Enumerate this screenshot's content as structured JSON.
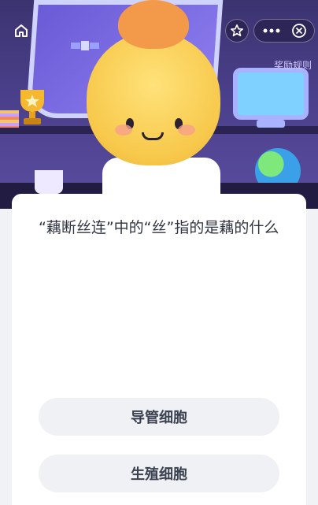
{
  "header": {
    "home_icon": "home-icon",
    "star_icon": "star-icon",
    "more_icon": "more-icon",
    "close_icon": "close-icon",
    "reward_rules": "奖励规则"
  },
  "question": {
    "text": "“藕断丝连”中的“丝”指的是藕的什么"
  },
  "options": [
    {
      "label": "导管细胞"
    },
    {
      "label": "生殖细胞"
    }
  ],
  "colors": {
    "hero_background": "#4a3f8a",
    "card_background": "#ffffff",
    "option_background": "#f0f1f4",
    "question_text": "#2f3542"
  }
}
